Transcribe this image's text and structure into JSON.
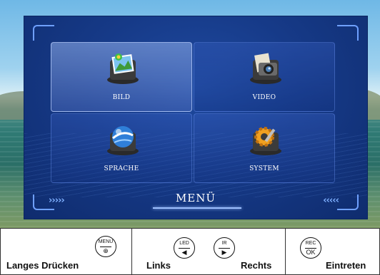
{
  "menu": {
    "title": "MENÜ",
    "left_arrows": "›››››",
    "right_arrows": "‹‹‹‹‹",
    "items": [
      {
        "label": "BILD",
        "icon": "picture-icon",
        "selected": true
      },
      {
        "label": "VIDEO",
        "icon": "camera-icon",
        "selected": false
      },
      {
        "label": "SPRACHE",
        "icon": "globe-icon",
        "selected": false
      },
      {
        "label": "SYSTEM",
        "icon": "gear-icon",
        "selected": false
      }
    ]
  },
  "legend": {
    "long_press": "Langes Drücken",
    "menu_button": {
      "top": "MENU",
      "bottom": "⊕"
    },
    "left": "Links",
    "led_button": {
      "top": "LED",
      "bottom": "◀"
    },
    "ir_button": {
      "top": "IR",
      "bottom": "▶"
    },
    "right": "Rechts",
    "rec_button": {
      "top": "REC",
      "bottom": "OK"
    },
    "enter": "Eintreten"
  },
  "colors": {
    "panel": "#163a88",
    "accent": "#7fb0ff",
    "text": "#ffffff"
  }
}
